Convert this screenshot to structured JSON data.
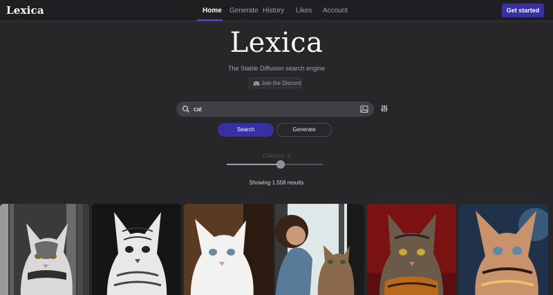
{
  "nav": {
    "logo": "Lexica",
    "links": [
      {
        "label": "Home"
      },
      {
        "label": "Generate"
      },
      {
        "label": "History"
      },
      {
        "label": "Likes"
      },
      {
        "label": "Account"
      }
    ],
    "cta": "Get started"
  },
  "hero": {
    "title": "Lexica",
    "subtitle": "The Stable Diffusion search engine",
    "discord": "Join the Discord"
  },
  "search": {
    "value": "cat",
    "search_button": "Search",
    "generate_button": "Generate"
  },
  "columns": {
    "label": "Columns: 6",
    "value": 6,
    "min": 1,
    "max": 10
  },
  "results": "Showing 1.558 results",
  "colors": {
    "accent": "#3730a3",
    "background": "#27272a"
  },
  "gallery": [
    {
      "icon": "cat-image"
    },
    {
      "icon": "cat-image"
    },
    {
      "icon": "cat-image"
    },
    {
      "icon": "cat-image"
    },
    {
      "icon": "cat-image"
    },
    {
      "icon": "cat-image"
    }
  ]
}
